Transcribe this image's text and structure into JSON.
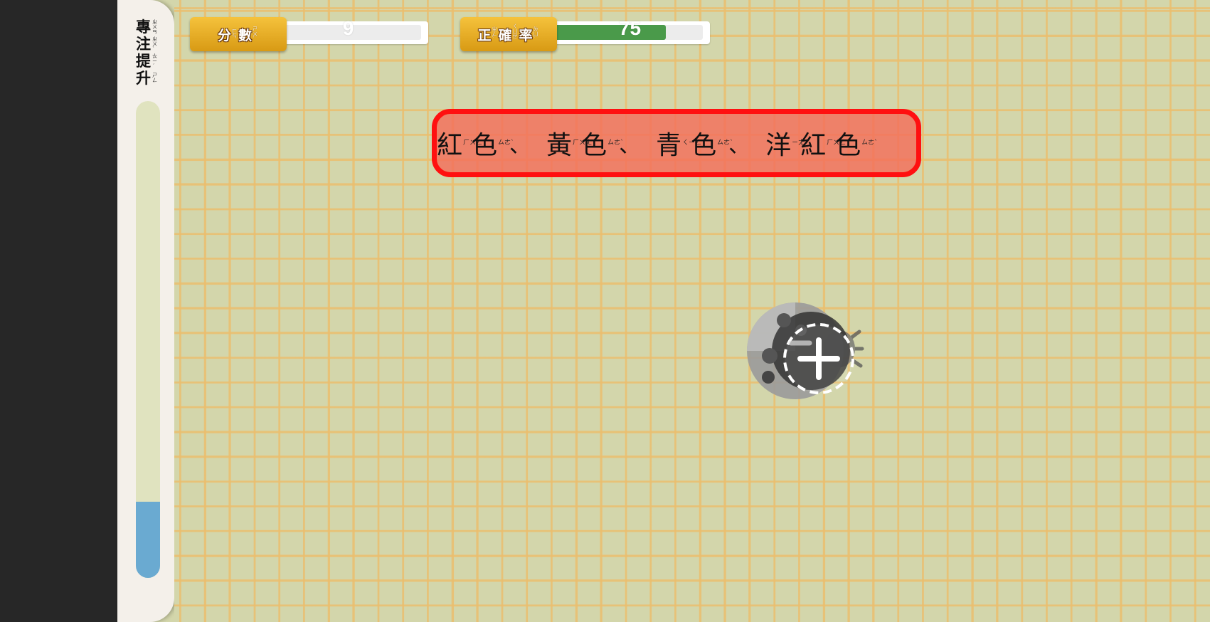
{
  "sidebar": {
    "title_chars": [
      {
        "char": "專",
        "zhuyin": "ㄓㄨㄢ"
      },
      {
        "char": "注",
        "zhuyin": "ㄓㄨˋ"
      },
      {
        "char": "提",
        "zhuyin": "ㄊㄧˊ"
      },
      {
        "char": "升",
        "zhuyin": "ㄕㄥ"
      }
    ],
    "focus_level": 0.16
  },
  "score": {
    "label_chars": [
      {
        "char": "分",
        "zhuyin": "ㄈㄣ"
      },
      {
        "char": "數",
        "zhuyin": "ㄕㄨˋ"
      }
    ],
    "value": "9",
    "fill": 0.07,
    "color": "#3566c4"
  },
  "accuracy": {
    "label_chars": [
      {
        "char": "正",
        "zhuyin": "ㄓㄥˋ"
      },
      {
        "char": "確",
        "zhuyin": "ㄑㄩㄝˋ"
      },
      {
        "char": "率",
        "zhuyin": "ㄌㄩˋ"
      }
    ],
    "value": "75",
    "fill": 0.75,
    "color": "#4a9a4a"
  },
  "prompt": {
    "items": [
      [
        {
          "char": "紅",
          "zhuyin": "ㄏㄨㄥˊ"
        },
        {
          "char": "色",
          "zhuyin": "ㄙㄜˋ"
        }
      ],
      [
        {
          "char": "黃",
          "zhuyin": "ㄏㄨㄤˊ"
        },
        {
          "char": "色",
          "zhuyin": "ㄙㄜˋ"
        }
      ],
      [
        {
          "char": "青",
          "zhuyin": "ㄑㄧㄥ"
        },
        {
          "char": "色",
          "zhuyin": "ㄙㄜˋ"
        }
      ],
      [
        {
          "char": "洋",
          "zhuyin": "ㄧㄤˊ"
        },
        {
          "char": "紅",
          "zhuyin": "ㄏㄨㄥˊ"
        },
        {
          "char": "色",
          "zhuyin": "ㄙㄜˋ"
        }
      ]
    ],
    "separator": "、",
    "border_color": "#ff1010"
  },
  "target": {
    "icon": "ladybug-icon",
    "cursor_icon": "add-target-icon"
  }
}
